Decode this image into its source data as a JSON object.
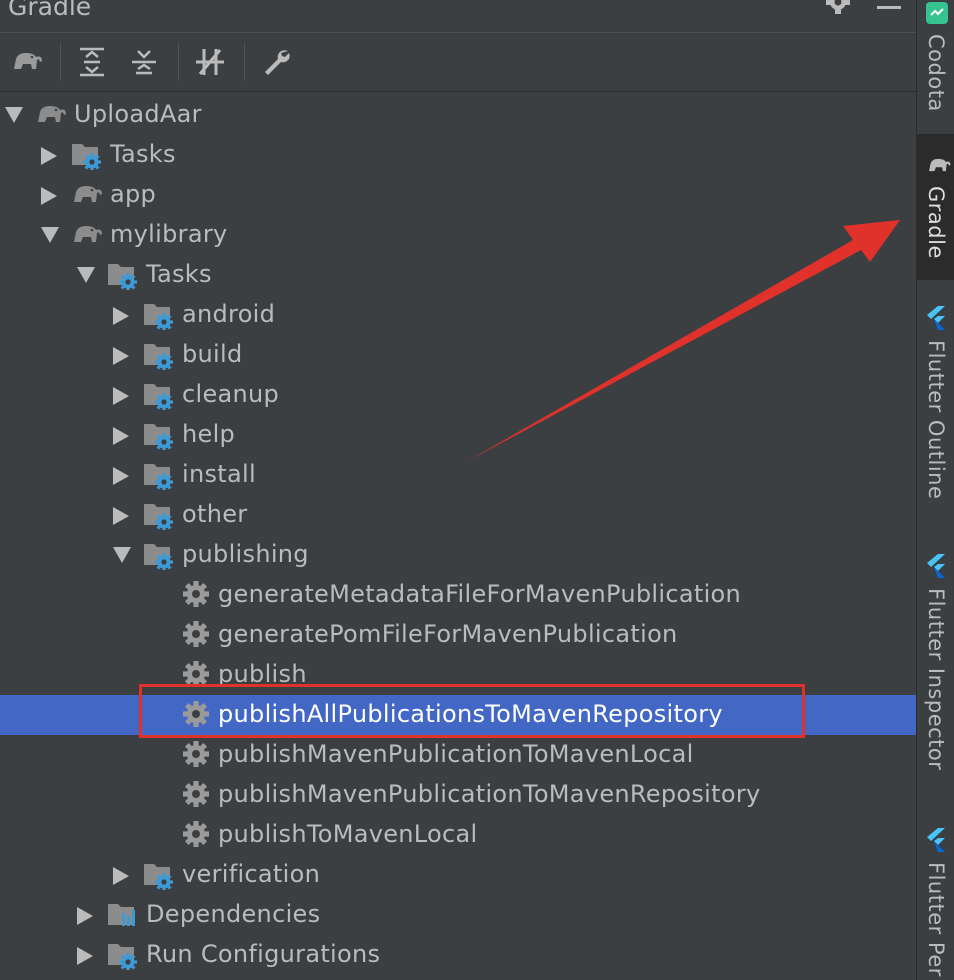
{
  "panel": {
    "title": "Gradle"
  },
  "toolbar": {
    "buttons": [
      {
        "icon": "elephant-icon",
        "name": "gradle-refresh-button"
      },
      {
        "icon": "expand-all-icon",
        "name": "expand-all-button"
      },
      {
        "icon": "collapse-all-icon",
        "name": "collapse-all-button"
      },
      {
        "icon": "toggle-offline-icon",
        "name": "toggle-offline-button"
      },
      {
        "icon": "wrench-icon",
        "name": "build-settings-button"
      }
    ]
  },
  "tree": {
    "items": [
      {
        "label": "UploadAar",
        "depth": 0,
        "icon": "elephant-icon",
        "expanded": true
      },
      {
        "label": "Tasks",
        "depth": 1,
        "icon": "task-folder-icon",
        "expanded": false
      },
      {
        "label": "app",
        "depth": 1,
        "icon": "elephant-icon",
        "expanded": false
      },
      {
        "label": "mylibrary",
        "depth": 1,
        "icon": "elephant-icon",
        "expanded": true
      },
      {
        "label": "Tasks",
        "depth": 2,
        "icon": "task-folder-icon",
        "expanded": true
      },
      {
        "label": "android",
        "depth": 3,
        "icon": "task-folder-icon",
        "expanded": false
      },
      {
        "label": "build",
        "depth": 3,
        "icon": "task-folder-icon",
        "expanded": false
      },
      {
        "label": "cleanup",
        "depth": 3,
        "icon": "task-folder-icon",
        "expanded": false
      },
      {
        "label": "help",
        "depth": 3,
        "icon": "task-folder-icon",
        "expanded": false
      },
      {
        "label": "install",
        "depth": 3,
        "icon": "task-folder-icon",
        "expanded": false
      },
      {
        "label": "other",
        "depth": 3,
        "icon": "task-folder-icon",
        "expanded": false
      },
      {
        "label": "publishing",
        "depth": 3,
        "icon": "task-folder-icon",
        "expanded": true
      },
      {
        "label": "generateMetadataFileForMavenPublication",
        "depth": 4,
        "icon": "gear-icon",
        "leaf": true
      },
      {
        "label": "generatePomFileForMavenPublication",
        "depth": 4,
        "icon": "gear-icon",
        "leaf": true
      },
      {
        "label": "publish",
        "depth": 4,
        "icon": "gear-icon",
        "leaf": true
      },
      {
        "label": "publishAllPublicationsToMavenRepository",
        "depth": 4,
        "icon": "gear-icon",
        "leaf": true,
        "selected": true
      },
      {
        "label": "publishMavenPublicationToMavenLocal",
        "depth": 4,
        "icon": "gear-icon",
        "leaf": true
      },
      {
        "label": "publishMavenPublicationToMavenRepository",
        "depth": 4,
        "icon": "gear-icon",
        "leaf": true
      },
      {
        "label": "publishToMavenLocal",
        "depth": 4,
        "icon": "gear-icon",
        "leaf": true
      },
      {
        "label": "verification",
        "depth": 3,
        "icon": "task-folder-icon",
        "expanded": false
      },
      {
        "label": "Dependencies",
        "depth": 2,
        "icon": "dependencies-folder-icon",
        "expanded": false
      },
      {
        "label": "Run Configurations",
        "depth": 2,
        "icon": "task-folder-icon",
        "expanded": false
      }
    ]
  },
  "sidebar": {
    "tabs": [
      {
        "label": "Codota",
        "icon": "codota-icon",
        "active": false
      },
      {
        "label": "Gradle",
        "icon": "elephant-icon",
        "active": true
      },
      {
        "label": "Flutter Outline",
        "icon": "flutter-icon",
        "active": false
      },
      {
        "label": "Flutter Inspector",
        "icon": "flutter-icon",
        "active": false
      },
      {
        "label": "Flutter Per",
        "icon": "flutter-icon",
        "active": false
      }
    ]
  },
  "colors": {
    "background": "#3c3f41",
    "selection": "#4267c4",
    "text": "#bbbbbb",
    "annotation": "#e0312b",
    "task_blue": "#3d9ad6",
    "flutter_blue": "#47c5fb"
  }
}
